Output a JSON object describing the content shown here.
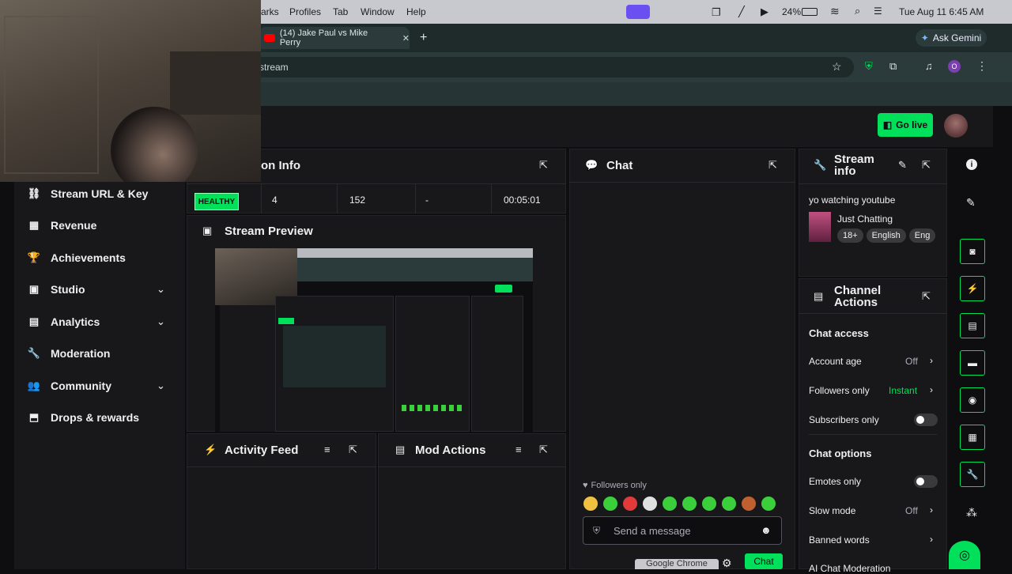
{
  "menubar": {
    "items": [
      "arks",
      "Profiles",
      "Tab",
      "Window",
      "Help"
    ],
    "battery": "24%",
    "datetime": "Tue Aug 11  6:45 AM"
  },
  "browser": {
    "tab_title": "(14) Jake Paul vs Mike Perry",
    "url_fragment": "stream",
    "ask_gemini": "Ask Gemini",
    "profile_initial": "O"
  },
  "header": {
    "go_live": "Go live"
  },
  "nav": {
    "items": [
      {
        "label": "Stream URL & Key",
        "icon": "link-icon"
      },
      {
        "label": "Revenue",
        "icon": "revenue-icon"
      },
      {
        "label": "Achievements",
        "icon": "trophy-icon"
      },
      {
        "label": "Studio",
        "icon": "studio-icon"
      },
      {
        "label": "Analytics",
        "icon": "analytics-icon"
      },
      {
        "label": "Moderation",
        "icon": "wrench-icon"
      },
      {
        "label": "Community",
        "icon": "community-icon"
      },
      {
        "label": "Drops & rewards",
        "icon": "drops-icon"
      }
    ]
  },
  "session": {
    "title": "on Info",
    "health": "HEALTHY",
    "stats": [
      "4",
      "152",
      "-",
      "00:05:01"
    ]
  },
  "preview": {
    "title": "Stream Preview"
  },
  "activity": {
    "title": "Activity Feed"
  },
  "mod_actions": {
    "title": "Mod Actions"
  },
  "chat": {
    "title": "Chat",
    "followers_only": "Followers only",
    "placeholder": "Send a message",
    "chat_button": "Chat",
    "tooltip": "Google Chrome"
  },
  "stream_info": {
    "title": "Stream info",
    "stream_title": "yo watching youtube",
    "category": "Just Chatting",
    "tags": [
      "18+",
      "English",
      "Eng"
    ]
  },
  "channel_actions": {
    "title": "Channel Actions",
    "chat_access_heading": "Chat access",
    "account_age": "Account age",
    "account_age_val": "Off",
    "followers_only": "Followers only",
    "followers_only_val": "Instant",
    "subscribers_only": "Subscribers only",
    "chat_options_heading": "Chat options",
    "emotes_only": "Emotes only",
    "slow_mode": "Slow mode",
    "slow_mode_val": "Off",
    "banned_words": "Banned words",
    "ai_moderation": "AI Chat Moderation"
  },
  "colors": {
    "accent": "#00e05a",
    "panel": "#18181b",
    "bg": "#0e0e10"
  }
}
